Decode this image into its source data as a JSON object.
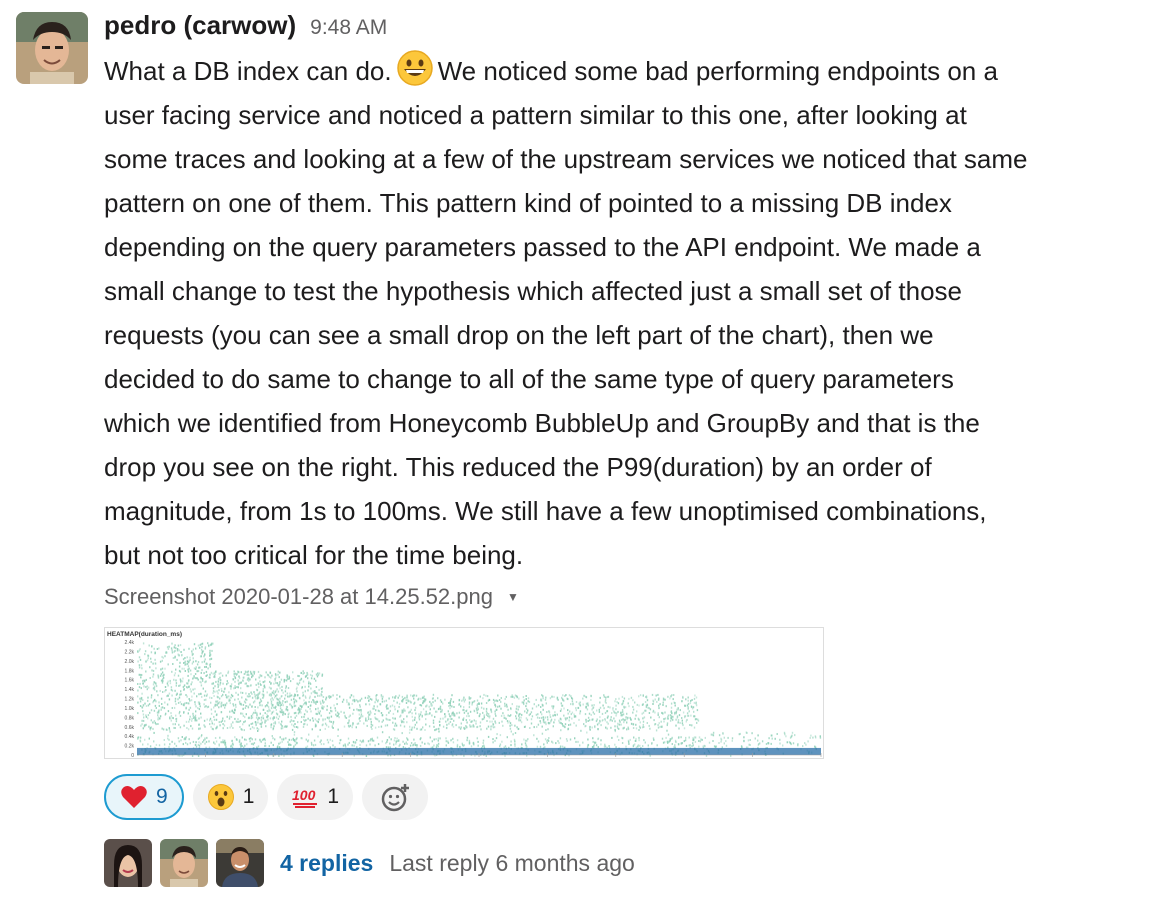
{
  "message": {
    "author": "pedro (carwow)",
    "time": "9:48 AM",
    "emoji": "grinning-face",
    "lines": [
      "We noticed some bad performing endpoints on a",
      "user facing service and noticed a pattern similar to this one, after looking at",
      "some traces and looking at a few of the upstream services we noticed that same",
      "pattern on one of them. This pattern kind of pointed to a missing DB index",
      "depending on the query parameters passed to the API endpoint. We made a",
      "small change to test the hypothesis which affected just a small set of those",
      "requests (you can see a small drop on the left part of the chart), then we",
      "decided to do same to change to all of the same type of query parameters",
      "which we identified from Honeycomb BubbleUp and GroupBy and that is the",
      "drop you see on the right. This reduced the P99(duration) by an order of",
      "magnitude, from 1s to 100ms. We still have a few unoptimised combinations,",
      "but not too critical for the time being."
    ],
    "first_line_prefix": "What a DB index can do."
  },
  "attachment": {
    "filename": "Screenshot 2020-01-28 at 14.25.52.png",
    "caret_icon": "caret-down-icon"
  },
  "chart_data": {
    "type": "heatmap",
    "title": "HEATMAP(duration_ms)",
    "y_ticks": [
      "2.4k",
      "2.2k",
      "2.0k",
      "1.8k",
      "1.6k",
      "1.4k",
      "1.2k",
      "1.0k",
      "0.8k",
      "0.6k",
      "0.4k",
      "0.2k",
      "0"
    ],
    "ylim": [
      0,
      2400
    ],
    "regions": [
      {
        "x_start": 0.0,
        "x_end": 0.11,
        "upper_duration_ms": 2400,
        "density": "high"
      },
      {
        "x_start": 0.11,
        "x_end": 0.27,
        "upper_duration_ms": 1800,
        "density": "high"
      },
      {
        "x_start": 0.27,
        "x_end": 0.82,
        "upper_duration_ms": 1300,
        "density": "medium"
      },
      {
        "x_start": 0.82,
        "x_end": 1.0,
        "upper_duration_ms": 500,
        "density": "low"
      }
    ],
    "gap_band_ms": [
      400,
      550
    ],
    "color_scatter": "#8fd0b8",
    "color_base": "#2a6fa8"
  },
  "reactions": [
    {
      "emoji": "heart",
      "count": "9",
      "active": true
    },
    {
      "emoji": "open-mouth",
      "count": "1",
      "active": false
    },
    {
      "emoji": "hundred-points",
      "count": "1",
      "active": false
    }
  ],
  "add_reaction_icon": "add-reaction-icon",
  "thread": {
    "replies": "4 replies",
    "last_reply": "Last reply 6 months ago"
  }
}
